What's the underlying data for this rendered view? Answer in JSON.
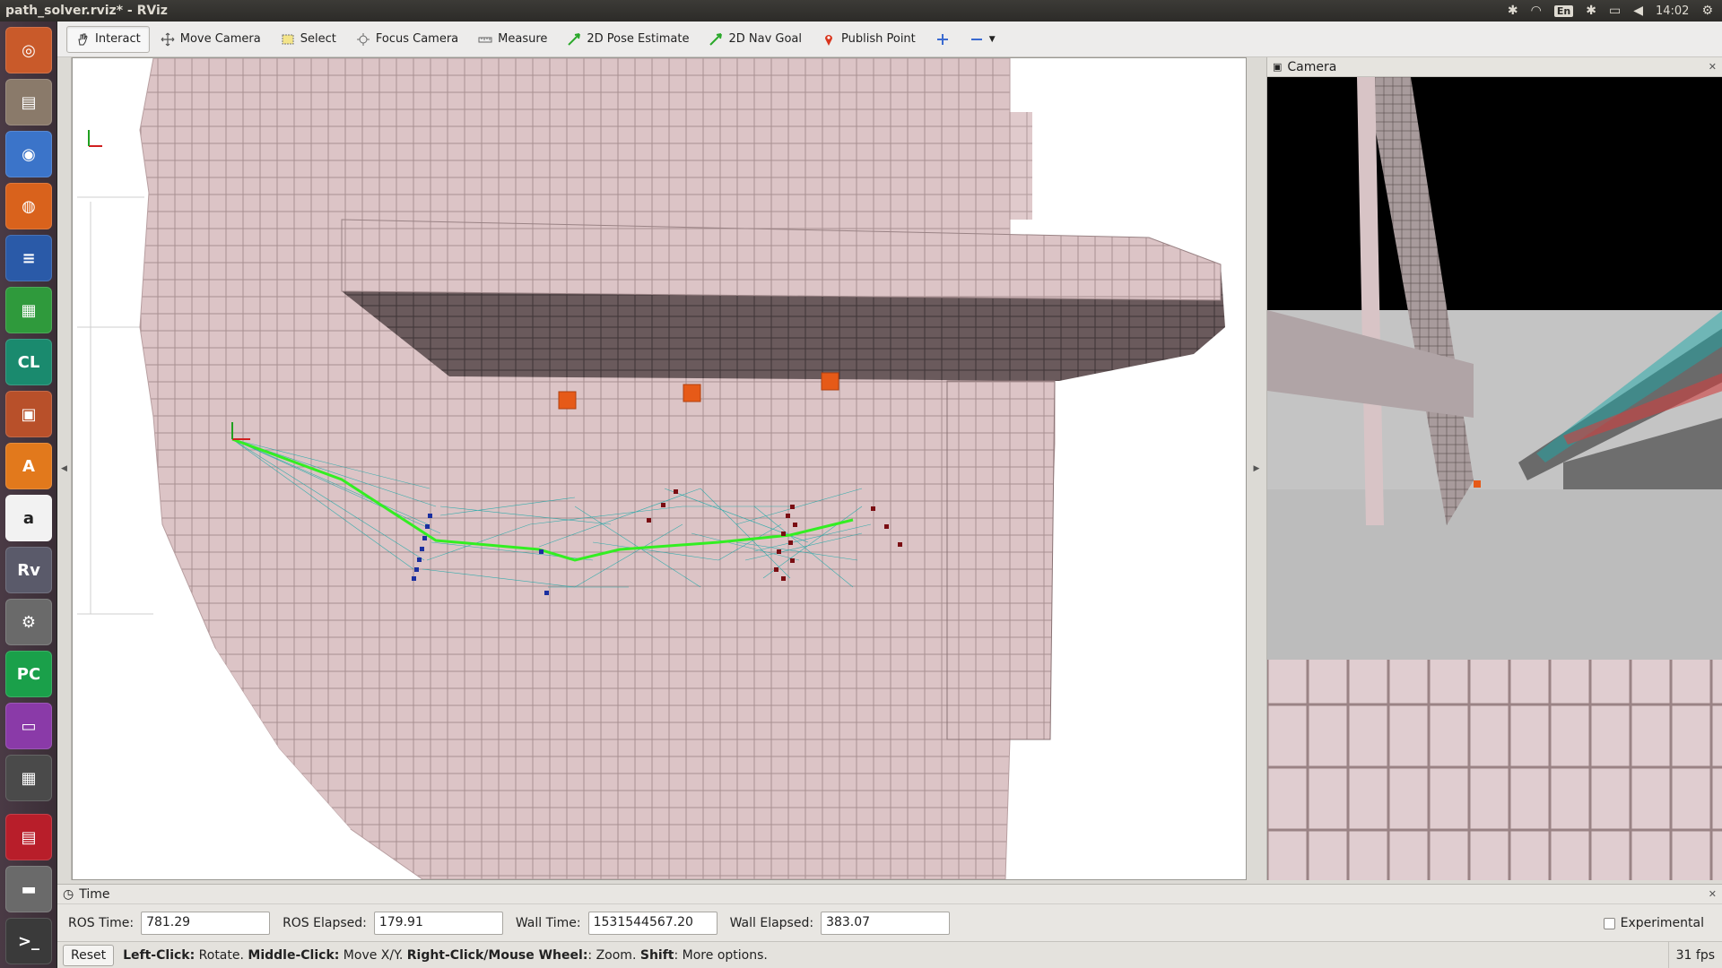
{
  "window": {
    "title": "path_solver.rviz* - RViz"
  },
  "tray": {
    "lang": "En",
    "clock": "14:02"
  },
  "toolbar": {
    "tools": [
      {
        "label": "Interact",
        "icon": "hand-icon",
        "active": true
      },
      {
        "label": "Move Camera",
        "icon": "move-camera-icon",
        "active": false
      },
      {
        "label": "Select",
        "icon": "select-icon",
        "active": false
      },
      {
        "label": "Focus Camera",
        "icon": "focus-camera-icon",
        "active": false
      },
      {
        "label": "Measure",
        "icon": "measure-icon",
        "active": false
      },
      {
        "label": "2D Pose Estimate",
        "icon": "pose-estimate-icon",
        "active": false
      },
      {
        "label": "2D Nav Goal",
        "icon": "nav-goal-icon",
        "active": false
      },
      {
        "label": "Publish Point",
        "icon": "publish-point-icon",
        "active": false
      }
    ]
  },
  "camera_panel": {
    "title": "Camera"
  },
  "time_panel": {
    "title": "Time",
    "ros_time_label": "ROS Time:",
    "ros_time": "781.29",
    "ros_elapsed_label": "ROS Elapsed:",
    "ros_elapsed": "179.91",
    "wall_time_label": "Wall Time:",
    "wall_time": "1531544567.20",
    "wall_elapsed_label": "Wall Elapsed:",
    "wall_elapsed": "383.07",
    "experimental_label": "Experimental"
  },
  "status": {
    "reset_label": "Reset",
    "k1": "Left-Click:",
    "v1": " Rotate. ",
    "k2": "Middle-Click:",
    "v2": " Move X/Y. ",
    "k3": "Right-Click/Mouse Wheel:",
    "v3": ": Zoom. ",
    "k4": "Shift",
    "v4": ": More options.",
    "fps": "31 fps"
  },
  "colors": {
    "voxel": "#d9bfc0",
    "path": "#33ee22",
    "graph": "#1aa8a8",
    "start": "#1a2fa0",
    "goal": "#7a0d12",
    "marker": "#e65a18"
  }
}
